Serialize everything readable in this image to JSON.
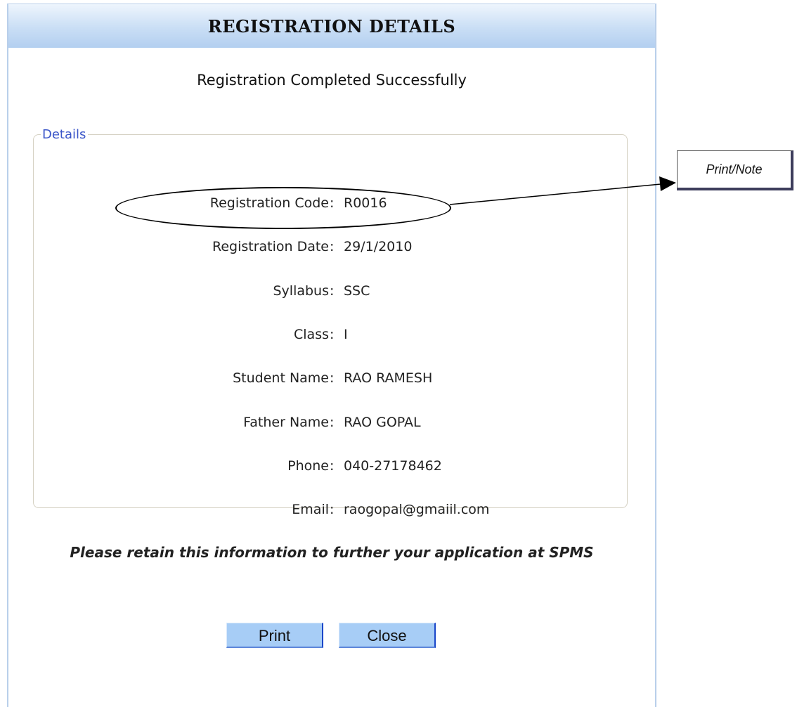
{
  "header": {
    "title": "REGISTRATION DETAILS"
  },
  "status_message": "Registration Completed Successfully",
  "details": {
    "legend": "Details",
    "fields": [
      {
        "label": "Registration Code",
        "value": "R0016"
      },
      {
        "label": "Registration Date",
        "value": "29/1/2010"
      },
      {
        "label": "Syllabus",
        "value": "SSC"
      },
      {
        "label": "Class",
        "value": "I"
      },
      {
        "label": "Student Name",
        "value": "RAO RAMESH"
      },
      {
        "label": "Father Name",
        "value": "RAO GOPAL"
      },
      {
        "label": "Phone",
        "value": "040-27178462"
      },
      {
        "label": "Email",
        "value": "raogopal@gmaiil.com"
      }
    ]
  },
  "notice": "Please retain this information to further your application at SPMS",
  "buttons": {
    "print_label": "Print",
    "close_label": "Close"
  },
  "annotation": {
    "callout_label": "Print/Note"
  }
}
